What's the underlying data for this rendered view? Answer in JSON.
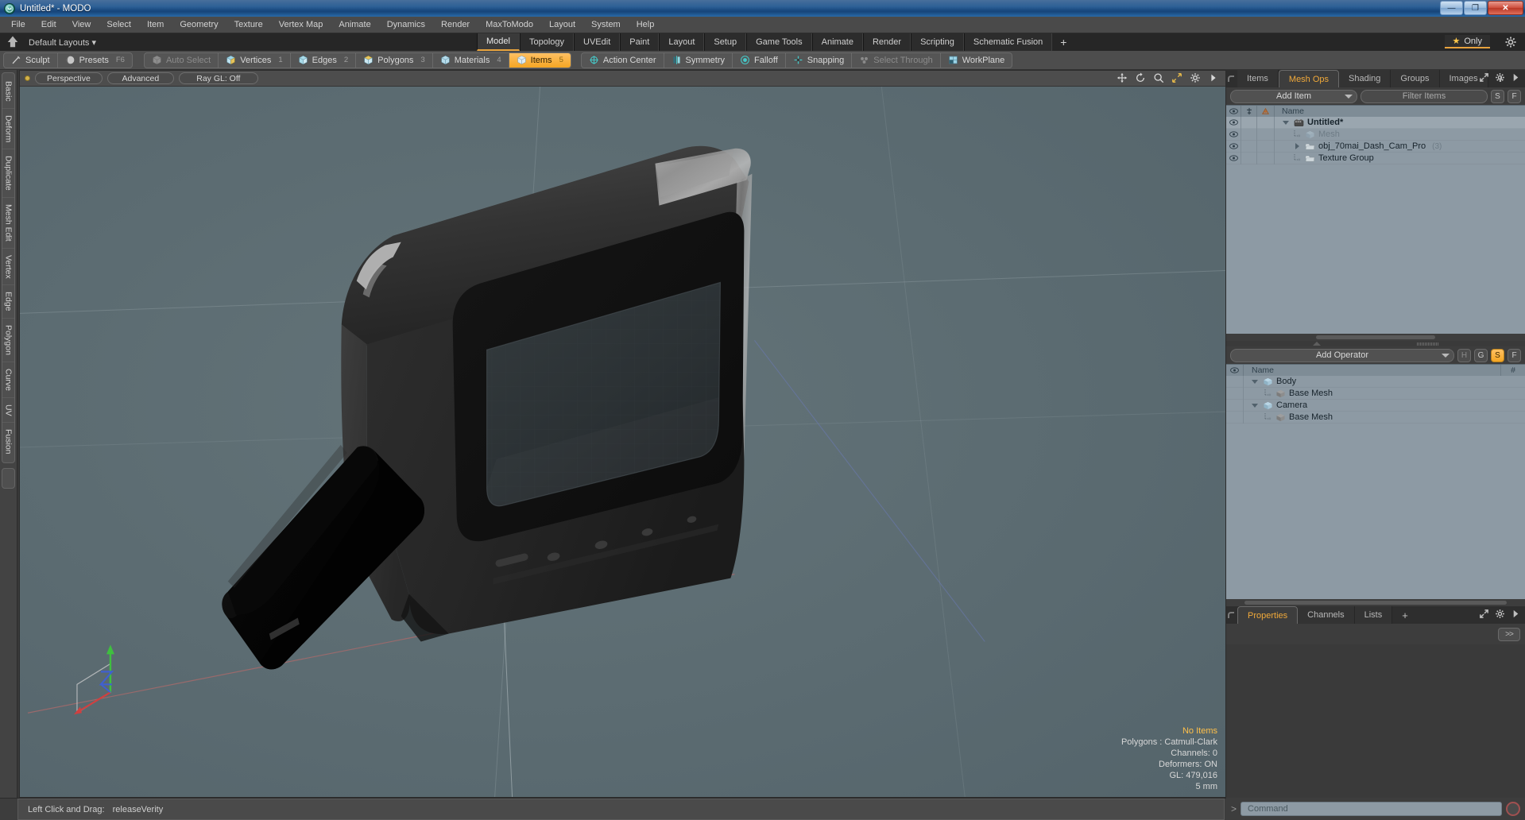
{
  "window": {
    "title": "Untitled* - MODO",
    "app_icon": "modo-logo-icon",
    "buttons": {
      "minimize": "—",
      "maximize": "❐",
      "close": "✕"
    }
  },
  "menubar": {
    "items": [
      "File",
      "Edit",
      "View",
      "Select",
      "Item",
      "Geometry",
      "Texture",
      "Vertex Map",
      "Animate",
      "Dynamics",
      "Render",
      "MaxToModo",
      "Layout",
      "System",
      "Help"
    ]
  },
  "layoutbar": {
    "home_icon": "home-icon",
    "label": "Default Layouts",
    "caret": "▾",
    "tabs": [
      {
        "label": "Model",
        "active": true
      },
      {
        "label": "Topology",
        "active": false
      },
      {
        "label": "UVEdit",
        "active": false
      },
      {
        "label": "Paint",
        "active": false
      },
      {
        "label": "Layout",
        "active": false
      },
      {
        "label": "Setup",
        "active": false
      },
      {
        "label": "Game Tools",
        "active": false
      },
      {
        "label": "Animate",
        "active": false
      },
      {
        "label": "Render",
        "active": false
      },
      {
        "label": "Scripting",
        "active": false
      },
      {
        "label": "Schematic Fusion",
        "active": false
      }
    ],
    "add_tab": "+",
    "only_button": {
      "label": "Only",
      "star": "★"
    },
    "gear_icon": "gear-icon"
  },
  "toolbar": {
    "group1": [
      {
        "label": "Sculpt",
        "icon": "brush-icon",
        "state": "normal",
        "badge": ""
      },
      {
        "label": "Presets",
        "icon": "sphere-icon",
        "state": "normal",
        "badge": "F6"
      }
    ],
    "group2": [
      {
        "label": "Auto Select",
        "icon": "cube-grey-icon",
        "state": "dim",
        "badge": ""
      },
      {
        "label": "Vertices",
        "icon": "cube-vertex-icon",
        "state": "normal",
        "badge": "1"
      },
      {
        "label": "Edges",
        "icon": "cube-edge-icon",
        "state": "normal",
        "badge": "2"
      },
      {
        "label": "Polygons",
        "icon": "cube-poly-icon",
        "state": "normal",
        "badge": "3"
      },
      {
        "label": "Materials",
        "icon": "cube-material-icon",
        "state": "normal",
        "badge": "4"
      },
      {
        "label": "Items",
        "icon": "cube-items-icon",
        "state": "selected",
        "badge": "5"
      }
    ],
    "group3": [
      {
        "label": "Action Center",
        "icon": "action-center-icon",
        "state": "normal",
        "badge": ""
      },
      {
        "label": "Symmetry",
        "icon": "symmetry-icon",
        "state": "normal",
        "badge": ""
      },
      {
        "label": "Falloff",
        "icon": "falloff-icon",
        "state": "normal",
        "badge": ""
      },
      {
        "label": "Snapping",
        "icon": "snapping-icon",
        "state": "normal",
        "badge": ""
      },
      {
        "label": "Select Through",
        "icon": "select-through-icon",
        "state": "dim",
        "badge": ""
      },
      {
        "label": "WorkPlane",
        "icon": "workplane-icon",
        "state": "normal",
        "badge": ""
      }
    ]
  },
  "left_rail": {
    "tabs": [
      "Basic",
      "Deform",
      "Duplicate",
      "Mesh Edit",
      "Vertex",
      "Edge",
      "Polygon",
      "Curve",
      "UV",
      "Fusion"
    ]
  },
  "viewport": {
    "dot": "viewport-active-dot",
    "buttons": [
      "Perspective",
      "Advanced",
      "Ray GL: Off"
    ],
    "icons": [
      "move-icon",
      "rotate-icon",
      "zoom-icon",
      "fit-icon",
      "gear-icon",
      "arrow-right-icon"
    ],
    "stats": {
      "items": "No Items",
      "polygons": "Polygons : Catmull-Clark",
      "channels": "Channels: 0",
      "deformers": "Deformers: ON",
      "gl": "GL: 479,016",
      "scale": "5 mm"
    },
    "axis_gizmo": {
      "x": "x-axis",
      "y": "y-axis",
      "z": "z-axis"
    },
    "background_color": "#5d6d73"
  },
  "right_panel": {
    "tabs": [
      {
        "label": "Items",
        "active": false
      },
      {
        "label": "Mesh Ops",
        "active": true
      },
      {
        "label": "Shading",
        "active": false
      },
      {
        "label": "Groups",
        "active": false
      },
      {
        "label": "Images",
        "active": false
      }
    ],
    "add_tab": "+",
    "tab_actions": [
      "expand-icon",
      "gear-icon",
      "arrow-right-icon"
    ],
    "controls": {
      "add_item": "Add Item",
      "filter_placeholder": "Filter Items",
      "btn_s": "S",
      "btn_f": "F"
    },
    "list_header": {
      "eye": "eye-icon",
      "col2": "lock-icon",
      "col3": "render-icon",
      "name": "Name"
    },
    "items": [
      {
        "name": "Untitled*",
        "indent": 0,
        "bold": true,
        "icon": "scene-icon",
        "expander": "down",
        "count": "",
        "dim": false
      },
      {
        "name": "Mesh",
        "indent": 1,
        "bold": false,
        "icon": "mesh-icon",
        "expander": "leaf",
        "count": "",
        "dim": true
      },
      {
        "name": "obj_70mai_Dash_Cam_Pro",
        "indent": 1,
        "bold": false,
        "icon": "folder-icon",
        "expander": "right",
        "count": "(3)",
        "dim": false
      },
      {
        "name": "Texture Group",
        "indent": 1,
        "bold": false,
        "icon": "folder-icon",
        "expander": "leaf",
        "count": "",
        "dim": false
      }
    ]
  },
  "mesh_ops_panel": {
    "controls": {
      "add_operator": "Add Operator",
      "btn_h": "H",
      "btn_g": "G",
      "btn_s": "S",
      "btn_f": "F"
    },
    "list_header": {
      "eye": "eye-icon",
      "name": "Name",
      "hash": "#"
    },
    "items": [
      {
        "name": "Body",
        "indent": 0,
        "icon": "mesh-blue-icon",
        "expander": "down"
      },
      {
        "name": "Base Mesh",
        "indent": 1,
        "icon": "mesh-grey-icon",
        "expander": "leaf"
      },
      {
        "name": "Camera",
        "indent": 0,
        "icon": "mesh-blue-icon",
        "expander": "down"
      },
      {
        "name": "Base Mesh",
        "indent": 1,
        "icon": "mesh-grey-icon",
        "expander": "leaf"
      }
    ]
  },
  "bottom_panel": {
    "tabs": [
      {
        "label": "Properties",
        "active": true
      },
      {
        "label": "Channels",
        "active": false
      },
      {
        "label": "Lists",
        "active": false
      }
    ],
    "add_tab": "+",
    "tab_actions": [
      "expand-icon",
      "gear-icon",
      "arrow-right-icon"
    ],
    "chevron_button": ">>"
  },
  "statusbar": {
    "hint_label": "Left Click and Drag:",
    "hint_value": "releaseVerity"
  },
  "command_bar": {
    "prompt": ">",
    "placeholder": "Command",
    "record_icon": "record-icon"
  },
  "colors": {
    "accent": "#f5a623",
    "viewport_bg": "#5d6d73",
    "panel_bg": "#3d3d3d",
    "list_bg": "#8d9aa4"
  }
}
